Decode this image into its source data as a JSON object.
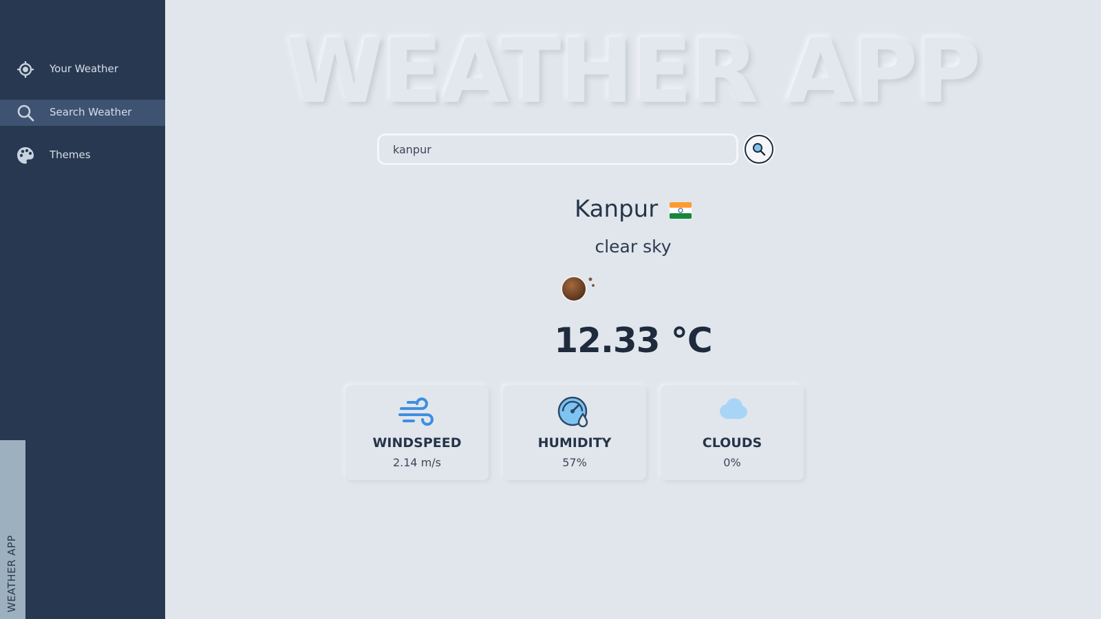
{
  "sidebar": {
    "items": [
      {
        "label": "Your Weather",
        "icon": "crosshair-icon"
      },
      {
        "label": "Search Weather",
        "icon": "search-icon"
      },
      {
        "label": "Themes",
        "icon": "palette-icon"
      }
    ],
    "active_index": 1,
    "vertical_tag": "WEATHER APP"
  },
  "header": {
    "hero_title": "WEATHER APP"
  },
  "search": {
    "value": "kanpur",
    "button_icon": "search-icon"
  },
  "weather": {
    "city": "Kanpur",
    "country_flag": "🇮🇳",
    "description": "clear sky",
    "condition_icon": "clear-night-moon-icon",
    "temperature": "12.33 °C"
  },
  "stats": [
    {
      "title": "WINDSPEED",
      "value": "2.14 m/s",
      "icon": "wind-icon"
    },
    {
      "title": "HUMIDITY",
      "value": "57%",
      "icon": "humidity-gauge-icon"
    },
    {
      "title": "CLOUDS",
      "value": "0%",
      "icon": "cloud-icon"
    }
  ],
  "colors": {
    "sidebar_bg": "#283850",
    "sidebar_active": "#3d5371",
    "page_bg": "#e1e6ec",
    "accent_blue": "#3d8fe0",
    "text_dark": "#263449"
  }
}
